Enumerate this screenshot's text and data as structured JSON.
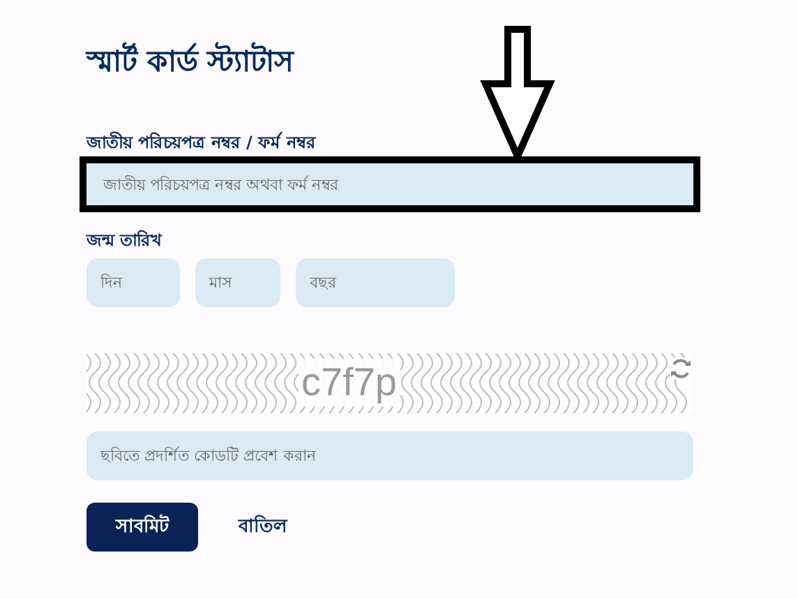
{
  "title": "স্মার্ট কার্ড স্ট্যাটাস",
  "id_field": {
    "label": "জাতীয় পরিচয়পত্র নম্বর / ফর্ম নম্বর",
    "placeholder": "জাতীয় পরিচয়পত্র নম্বর অথবা ফর্ম নম্বর",
    "highlighted": true
  },
  "birth_date": {
    "label": "জন্ম তারিখ",
    "fields": [
      {
        "placeholder": "দিন"
      },
      {
        "placeholder": "মাস"
      },
      {
        "placeholder": "বছর"
      }
    ]
  },
  "captcha": {
    "code": "c7f7p",
    "placeholder": "ছবিতে প্রদর্শিত কোডটি প্রবেশ করান"
  },
  "buttons": [
    {
      "label": "সাবমিট",
      "kind": "primary"
    },
    {
      "label": "বাতিল",
      "kind": "link"
    }
  ]
}
